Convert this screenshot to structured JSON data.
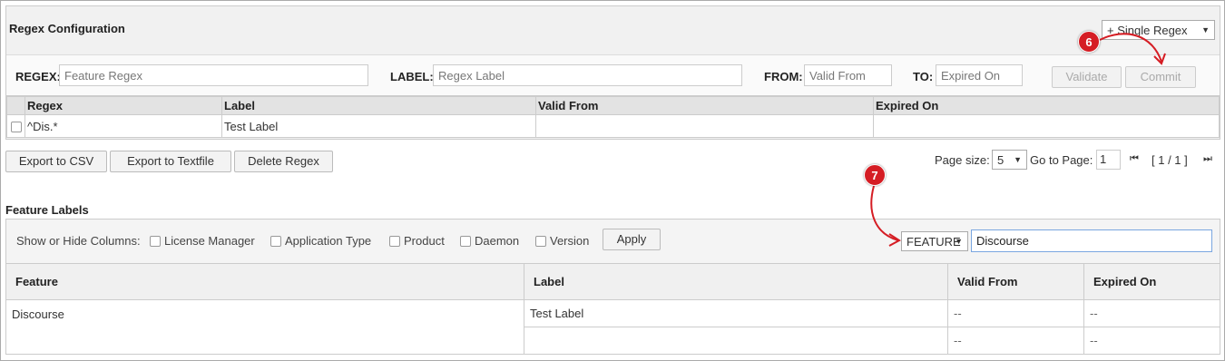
{
  "regex_config": {
    "title": "Regex Configuration",
    "add_select": "+ Single Regex",
    "form": {
      "regex_label": "REGEX:",
      "regex_placeholder": "Feature Regex",
      "label_label": "LABEL:",
      "label_placeholder": "Regex Label",
      "from_label": "FROM:",
      "from_placeholder": "Valid From",
      "to_label": "TO:",
      "to_placeholder": "Expired On",
      "validate": "Validate",
      "commit": "Commit"
    },
    "table": {
      "headers": [
        "Regex",
        "Label",
        "Valid From",
        "Expired On"
      ],
      "rows": [
        {
          "regex": "^Dis.*",
          "label": "Test Label",
          "valid_from": "",
          "expired_on": ""
        }
      ]
    },
    "actions": {
      "export_csv": "Export to CSV",
      "export_text": "Export to Textfile",
      "delete": "Delete Regex"
    },
    "pager": {
      "size_label": "Page size:",
      "size": "5",
      "goto_label": "Go to Page:",
      "page": "1",
      "status": "[ 1 / 1 ]"
    }
  },
  "annotations": {
    "step6": "6",
    "step7": "7",
    "color": "#d51d24"
  },
  "feature_labels": {
    "title": "Feature Labels",
    "columns_label": "Show or Hide Columns:",
    "columns": [
      "License Manager",
      "Application Type",
      "Product",
      "Daemon",
      "Version"
    ],
    "apply": "Apply",
    "filter_field": "FEATURE",
    "filter_value": "Discourse",
    "table": {
      "headers": [
        "Feature",
        "Label",
        "Valid From",
        "Expired On"
      ],
      "rows": [
        {
          "feature": "Discourse",
          "label": "Test Label",
          "valid_from": "--",
          "expired_on": "--"
        },
        {
          "feature": "",
          "label": "",
          "valid_from": "--",
          "expired_on": "--"
        }
      ]
    }
  }
}
